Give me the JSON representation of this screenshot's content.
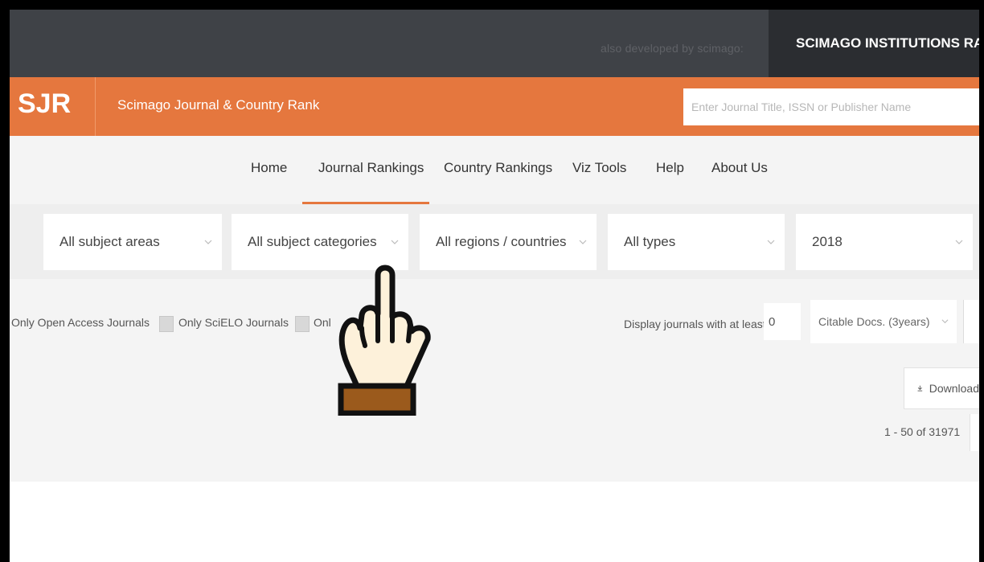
{
  "topbar": {
    "also_developed": "also developed by scimago:",
    "sir_label": "SCIMAGO INSTITUTIONS RA"
  },
  "brand": {
    "logo": "SJR",
    "name": "Scimago Journal & Country Rank",
    "search_placeholder": "Enter Journal Title, ISSN or Publisher Name",
    "accent_color": "#e5773e"
  },
  "nav": {
    "items": [
      {
        "label": "Home"
      },
      {
        "label": "Journal Rankings",
        "active": true
      },
      {
        "label": "Country Rankings"
      },
      {
        "label": "Viz Tools"
      },
      {
        "label": "Help"
      },
      {
        "label": "About Us"
      }
    ]
  },
  "filters": {
    "subject_areas": "All subject areas",
    "subject_categories": "All subject categories",
    "regions": "All regions / countries",
    "types": "All types",
    "year": "2018"
  },
  "options": {
    "open_access": "Only Open Access Journals",
    "scielo": "Only SciELO Journals",
    "third_partial": "Onl",
    "display_min_label": "Display journals with at least",
    "display_min_value": "0",
    "citable_select": "Citable Docs. (3years)",
    "download_label": "Download",
    "pagination": "1 - 50 of 31971"
  },
  "overlay": {
    "icon": "pointing-hand-icon"
  }
}
